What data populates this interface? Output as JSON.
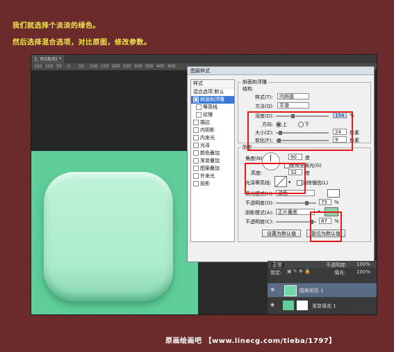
{
  "captions": {
    "line1": "我们就选择个淡淡的绿色。",
    "line2": "然后选择混合选项，对比原图，修改参数。"
  },
  "document": {
    "tab_label": "1, RGB/8) *",
    "ruler_ticks": [
      "150",
      "100",
      "50",
      "0",
      "50",
      "100",
      "150",
      "200",
      "250",
      "300",
      "350",
      "400",
      "450"
    ]
  },
  "dialog": {
    "title": "图层样式",
    "style_list": {
      "header": "样式",
      "blend_options": "混合选项:默认",
      "items": [
        {
          "label": "斜面和浮雕",
          "checked": true,
          "selected": true,
          "sub": false
        },
        {
          "label": "等高线",
          "checked": false,
          "selected": false,
          "sub": true
        },
        {
          "label": "纹理",
          "checked": false,
          "selected": false,
          "sub": true
        },
        {
          "label": "描边",
          "checked": false,
          "selected": false,
          "sub": false
        },
        {
          "label": "内阴影",
          "checked": false,
          "selected": false,
          "sub": false
        },
        {
          "label": "内发光",
          "checked": false,
          "selected": false,
          "sub": false
        },
        {
          "label": "光泽",
          "checked": false,
          "selected": false,
          "sub": false
        },
        {
          "label": "颜色叠加",
          "checked": false,
          "selected": false,
          "sub": false
        },
        {
          "label": "渐变叠加",
          "checked": false,
          "selected": false,
          "sub": false
        },
        {
          "label": "图案叠加",
          "checked": false,
          "selected": false,
          "sub": false
        },
        {
          "label": "外发光",
          "checked": false,
          "selected": false,
          "sub": false
        },
        {
          "label": "投影",
          "checked": false,
          "selected": false,
          "sub": false
        }
      ]
    },
    "bevel": {
      "section_title": "斜面和浮雕",
      "structure_title": "结构",
      "style_label": "样式(T):",
      "style_value": "内斜面",
      "technique_label": "方法(Q):",
      "technique_value": "平滑",
      "depth_label": "深度(D):",
      "depth_value": "154",
      "depth_unit": "%",
      "direction_label": "方向:",
      "direction_up": "上",
      "direction_down": "下",
      "size_label": "大小(Z):",
      "size_value": "24",
      "size_unit": "像素",
      "soften_label": "软化(F):",
      "soften_value": "9",
      "soften_unit": "像素"
    },
    "shading": {
      "section_title": "阴影",
      "angle_label": "角度(N):",
      "angle_value": "90",
      "angle_unit": "度",
      "global_light_label": "使用全局光(G)",
      "altitude_label": "高度:",
      "altitude_value": "32",
      "altitude_unit": "度",
      "gloss_contour_label": "光泽等高线:",
      "antialias_label": "消除锯齿(L)",
      "highlight_mode_label": "高光模式(H):",
      "highlight_mode_value": "滤色",
      "highlight_color": "#ffffff",
      "highlight_opacity_label": "不透明度(O):",
      "highlight_opacity_value": "75",
      "shadow_mode_label": "阴影模式(A):",
      "shadow_mode_value": "正片叠底",
      "shadow_color": "#8fd2a8",
      "shadow_opacity_label": "不透明度(C):",
      "shadow_opacity_value": "87",
      "percent": "%"
    },
    "buttons": {
      "make_default": "设置为默认值",
      "reset_default": "复位为默认值"
    }
  },
  "layers": {
    "blend_mode": "正常",
    "opacity_label": "不透明度:",
    "opacity_value": "100%",
    "lock_label": "锁定:",
    "fill_label": "填充:",
    "fill_value": "100%",
    "rows": [
      {
        "name": "圆角矩形 1",
        "thumb_color": "#6fd8a8"
      },
      {
        "name": "渐变填充 1",
        "thumb_color": "#ffffff"
      }
    ]
  },
  "watermark": "原画绘画吧 【www.linecg.com/tieba/1797】"
}
